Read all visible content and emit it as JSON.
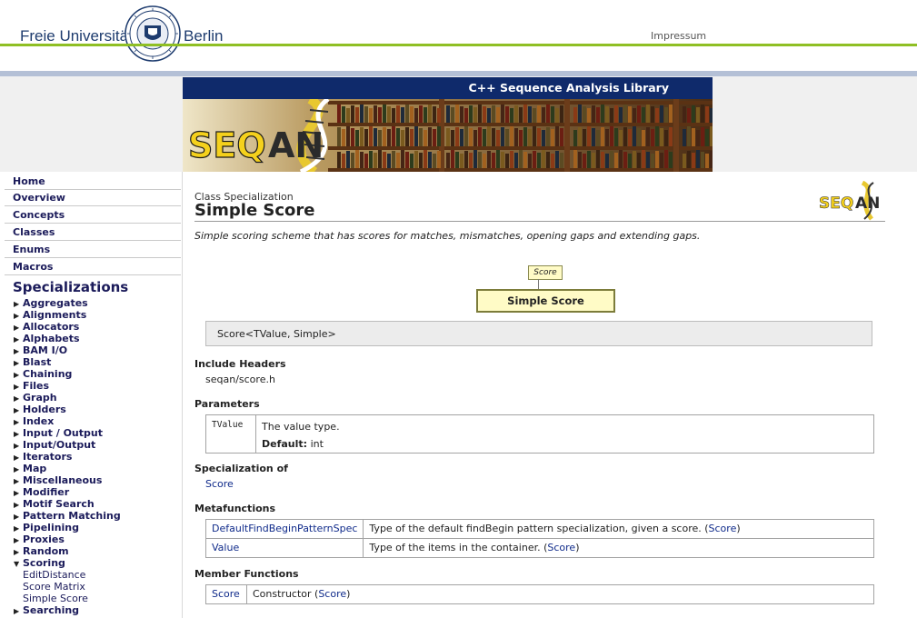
{
  "header": {
    "university_left": "Freie Universität",
    "university_right": "Berlin",
    "impressum": "Impressum"
  },
  "banner": {
    "title": "C++ Sequence Analysis Library",
    "logo_text_seq": "SEQ",
    "logo_text_an": "AN"
  },
  "sidebar": {
    "main_links": [
      "Home",
      "Overview",
      "Concepts",
      "Classes",
      "Enums",
      "Macros"
    ],
    "heading": "Specializations",
    "categories": [
      "Aggregates",
      "Alignments",
      "Allocators",
      "Alphabets",
      "BAM I/O",
      "Blast",
      "Chaining",
      "Files",
      "Graph",
      "Holders",
      "Index",
      "Input / Output",
      "Input/Output",
      "Iterators",
      "Map",
      "Miscellaneous",
      "Modifier",
      "Motif Search",
      "Pattern Matching",
      "Pipelining",
      "Proxies",
      "Random",
      "Scoring"
    ],
    "expanded_category": "Scoring",
    "scoring_items": [
      "EditDistance",
      "Score Matrix",
      "Simple Score"
    ],
    "after_categories": [
      "Searching"
    ]
  },
  "content": {
    "kind": "Class Specialization",
    "title": "Simple Score",
    "description": "Simple scoring scheme that has scores for matches, mismatches, opening gaps and extending gaps.",
    "diagram": {
      "parent": "Score",
      "child": "Simple Score"
    },
    "signature": "Score<TValue, Simple>",
    "include_headers": {
      "heading": "Include Headers",
      "value": "seqan/score.h"
    },
    "parameters": {
      "heading": "Parameters",
      "name": "TValue",
      "desc": "The value type.",
      "default_label": "Default:",
      "default_value": "int"
    },
    "specialization_of": {
      "heading": "Specialization of",
      "link": "Score"
    },
    "metafunctions": {
      "heading": "Metafunctions",
      "rows": [
        {
          "name": "DefaultFindBeginPatternSpec",
          "desc": "Type of the default findBegin pattern specialization, given a score. (",
          "link": "Score",
          "close": ")"
        },
        {
          "name": "Value",
          "desc": "Type of the items in the container. (",
          "link": "Score",
          "close": ")"
        }
      ]
    },
    "member_functions": {
      "heading": "Member Functions",
      "rows": [
        {
          "name": "Score",
          "desc": "Constructor (",
          "link": "Score",
          "close": ")"
        }
      ]
    }
  },
  "colors": {
    "green_line": "#8fbf24",
    "blue_line": "#b4c0d6",
    "banner_bar": "#0f2a6b",
    "link": "#0f2a8a",
    "diagram_fill": "#fffbc6"
  }
}
